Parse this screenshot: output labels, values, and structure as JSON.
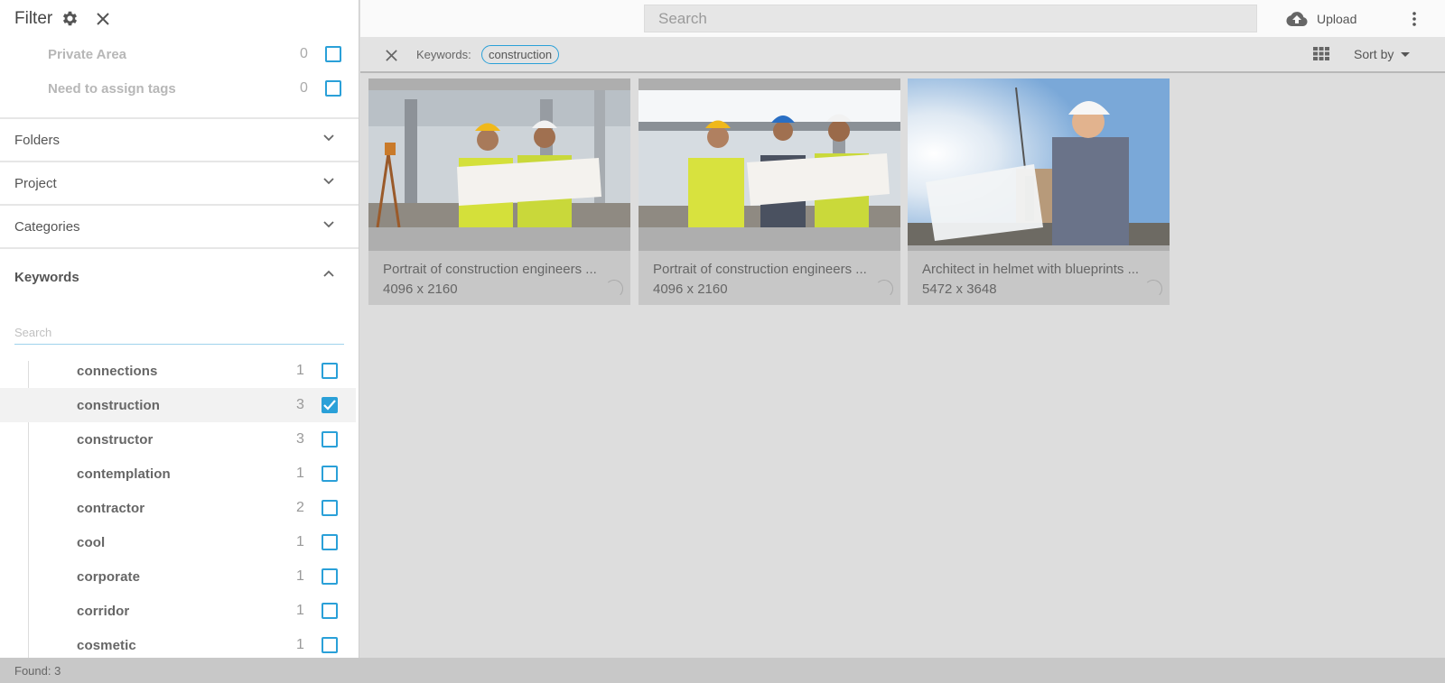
{
  "sidebar": {
    "title": "Filter",
    "flags": [
      {
        "label": "Private Area",
        "count": "0"
      },
      {
        "label": "Need to assign tags",
        "count": "0"
      }
    ],
    "sections": [
      "Folders",
      "Project",
      "Categories"
    ],
    "keywords_title": "Keywords",
    "keywords_search_placeholder": "Search",
    "keywords": [
      {
        "label": "connections",
        "count": "1",
        "checked": false
      },
      {
        "label": "construction",
        "count": "3",
        "checked": true
      },
      {
        "label": "constructor",
        "count": "3",
        "checked": false
      },
      {
        "label": "contemplation",
        "count": "1",
        "checked": false
      },
      {
        "label": "contractor",
        "count": "2",
        "checked": false
      },
      {
        "label": "cool",
        "count": "1",
        "checked": false
      },
      {
        "label": "corporate",
        "count": "1",
        "checked": false
      },
      {
        "label": "corridor",
        "count": "1",
        "checked": false
      },
      {
        "label": "cosmetic",
        "count": "1",
        "checked": false
      }
    ]
  },
  "topbar": {
    "search_placeholder": "Search",
    "upload_label": "Upload",
    "icons": [
      "cloud-upload-icon",
      "more-vertical-icon"
    ]
  },
  "filterbar": {
    "label": "Keywords:",
    "chip": "construction",
    "sort_label": "Sort by",
    "icons": [
      "close-icon",
      "grid-view-icon",
      "caret-down-icon"
    ]
  },
  "results": [
    {
      "caption": "Portrait of construction engineers ...",
      "dimensions": "4096 x 2160"
    },
    {
      "caption": "Portrait of construction engineers ...",
      "dimensions": "4096 x 2160"
    },
    {
      "caption": "Architect in helmet with blueprints ...",
      "dimensions": "5472 x 3648"
    }
  ],
  "status": {
    "found": "Found: 3"
  },
  "colors": {
    "accent": "#2aa0d8",
    "background": "#dddddd",
    "card": "#c7c7c7"
  }
}
